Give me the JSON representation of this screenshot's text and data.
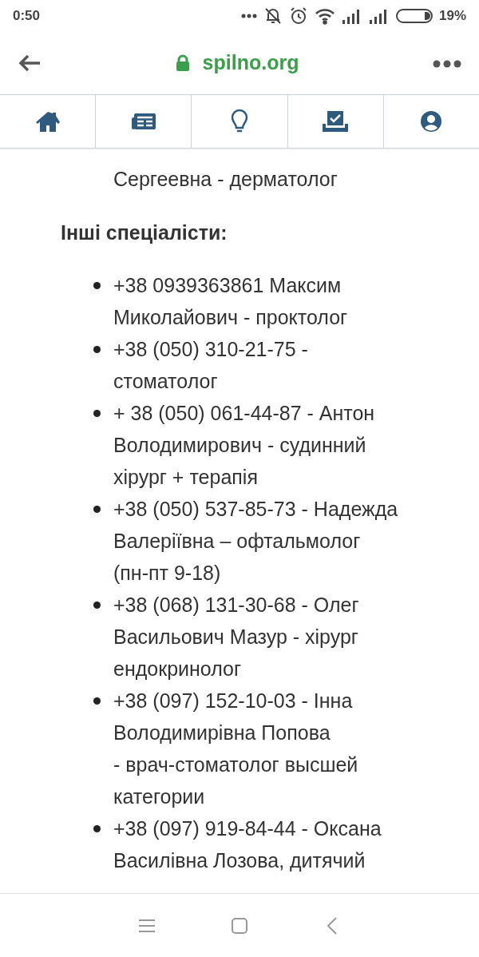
{
  "status_bar": {
    "time": "0:50",
    "battery": "19%"
  },
  "address_bar": {
    "url": "spilno.org",
    "secure": true
  },
  "tabs": [
    {
      "kind": "home",
      "selected": false
    },
    {
      "kind": "news",
      "selected": false
    },
    {
      "kind": "ideas",
      "selected": false
    },
    {
      "kind": "vote",
      "selected": false
    },
    {
      "kind": "profile",
      "selected": false
    }
  ],
  "content": {
    "previous_items": [
      {
        "lines": [
          "Сергеевна - дерматолог"
        ]
      }
    ],
    "heading": "Інші спеціалісти:",
    "items": [
      {
        "lines": [
          "+38 0939363861 Максим",
          "Миколайович - проктолог"
        ]
      },
      {
        "lines": [
          "+38 (050) 310-21-75 -",
          "стоматолог"
        ]
      },
      {
        "lines": [
          "+ 38 (050) 061-44-87 - Антон",
          "Володимирович - судинний",
          "хірург + терапія"
        ]
      },
      {
        "lines": [
          "+38 (050) 537-85-73 - Надежда",
          "Валеріївна – офтальмолог",
          "(пн-пт 9-18)"
        ]
      },
      {
        "lines": [
          "+38 (068) 131-30-68 - Олег",
          "Васильович Мазур - хірург",
          "ендокринолог"
        ]
      },
      {
        "lines": [
          "+38 (097) 152-10-03 - Інна",
          "Володимирівна Попова",
          "- врач-стоматолог высшей",
          "категории"
        ]
      },
      {
        "lines": [
          "+38 (097) 919-84-44 - Оксана",
          "Василівна Лозова, дитячий"
        ]
      }
    ]
  }
}
